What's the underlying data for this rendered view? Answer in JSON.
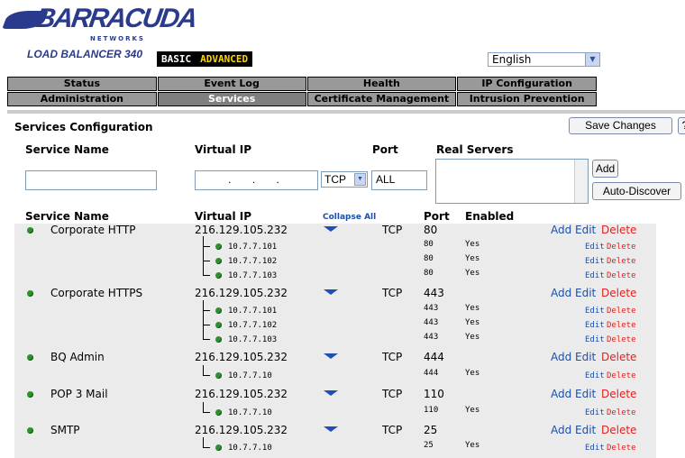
{
  "brand": {
    "name": "BARRACUDA",
    "sub": "NETWORKS",
    "product": "LOAD BALANCER 340"
  },
  "mode_tabs": [
    "BASIC",
    "ADVANCED"
  ],
  "language": {
    "value": "English"
  },
  "nav": {
    "row1": [
      "Status",
      "Event Log",
      "Health",
      "IP Configuration"
    ],
    "row2": [
      "Administration",
      "Services",
      "Certificate Management",
      "Intrusion Prevention"
    ]
  },
  "page": {
    "title": "Services Configuration",
    "save_label": "Save Changes",
    "help_label": "?"
  },
  "form": {
    "service_name_label": "Service Name",
    "virtual_ip_label": "Virtual IP",
    "port_label": "Port",
    "real_servers_label": "Real Servers",
    "vip_placeholder": ". . .",
    "protocol": "TCP",
    "port_value": "ALL",
    "add_label": "Add",
    "autodiscover_label": "Auto-Discover"
  },
  "table": {
    "headers": {
      "service_name": "Service Name",
      "virtual_ip": "Virtual IP",
      "collapse": "Collapse All",
      "port": "Port",
      "enabled": "Enabled"
    },
    "actions": {
      "add": "Add",
      "edit": "Edit",
      "delete": "Delete"
    },
    "services": [
      {
        "name": "Corporate HTTP",
        "vip": "216.129.105.232",
        "proto": "TCP",
        "port": "80",
        "servers": [
          {
            "ip": "10.7.7.101",
            "port": "80",
            "enabled": "Yes"
          },
          {
            "ip": "10.7.7.102",
            "port": "80",
            "enabled": "Yes"
          },
          {
            "ip": "10.7.7.103",
            "port": "80",
            "enabled": "Yes"
          }
        ]
      },
      {
        "name": "Corporate HTTPS",
        "vip": "216.129.105.232",
        "proto": "TCP",
        "port": "443",
        "servers": [
          {
            "ip": "10.7.7.101",
            "port": "443",
            "enabled": "Yes"
          },
          {
            "ip": "10.7.7.102",
            "port": "443",
            "enabled": "Yes"
          },
          {
            "ip": "10.7.7.103",
            "port": "443",
            "enabled": "Yes"
          }
        ]
      },
      {
        "name": "BQ Admin",
        "vip": "216.129.105.232",
        "proto": "TCP",
        "port": "444",
        "servers": [
          {
            "ip": "10.7.7.10",
            "port": "444",
            "enabled": "Yes"
          }
        ]
      },
      {
        "name": "POP 3 Mail",
        "vip": "216.129.105.232",
        "proto": "TCP",
        "port": "110",
        "servers": [
          {
            "ip": "10.7.7.10",
            "port": "110",
            "enabled": "Yes"
          }
        ]
      },
      {
        "name": "SMTP",
        "vip": "216.129.105.232",
        "proto": "TCP",
        "port": "25",
        "servers": [
          {
            "ip": "10.7.7.10",
            "port": "25",
            "enabled": "Yes"
          }
        ]
      }
    ]
  },
  "colors": {
    "brand": "#2a3a8c",
    "status_ok": "#2f8f2f",
    "link": "#1e4fa8",
    "delete": "#dd2222",
    "nav_bg": "#999999"
  }
}
